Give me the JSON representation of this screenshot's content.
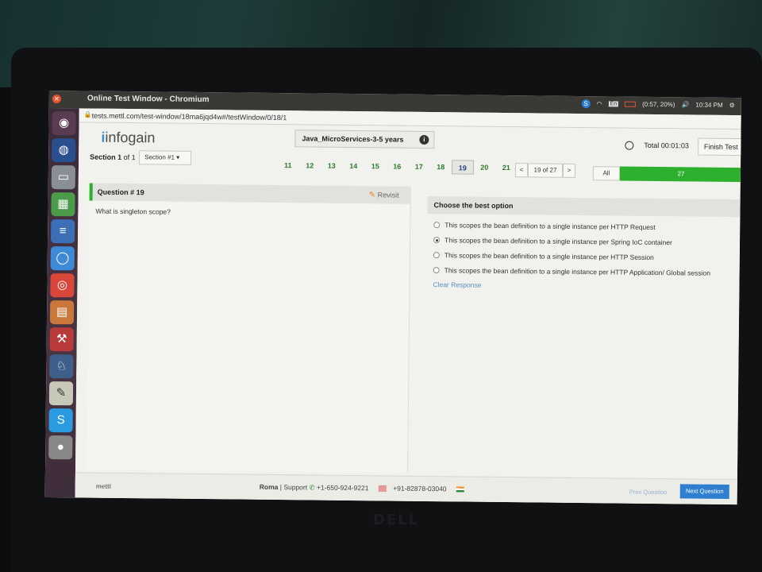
{
  "window": {
    "title": "Online Test Window - Chromium",
    "url": "tests.mettl.com/test-window/18ma6jqd4w#/testWindow/0/18/1"
  },
  "system_tray": {
    "keyboard": "En",
    "battery": "(0:57, 20%)",
    "time": "10:34 PM"
  },
  "launcher_icons": [
    "ubuntu-dash-icon",
    "network-sphere-icon",
    "files-icon",
    "spreadsheet-icon",
    "document-icon",
    "browser-icon",
    "chrome-icon",
    "presentation-icon",
    "settings-icon",
    "pgadmin-icon",
    "text-editor-icon",
    "skype-icon",
    "disk-icon"
  ],
  "header": {
    "logo": "infogain",
    "test_name": "Java_MicroServices-3-5 years",
    "total_label": "Total 00:01:03",
    "finish_label": "Finish Test"
  },
  "section": {
    "prefix": "Section",
    "number": "1",
    "of": "of 1",
    "selector": "Section #1"
  },
  "question_numbers": [
    "11",
    "12",
    "13",
    "14",
    "15",
    "16",
    "17",
    "18",
    "19",
    "20",
    "21"
  ],
  "current_question_index": 8,
  "pager": {
    "prev": "<",
    "position": "19 of 27",
    "next": ">"
  },
  "filter": {
    "all_label": "All",
    "count": "27"
  },
  "question": {
    "heading": "Question # 19",
    "revisit_label": "Revisit",
    "text": "What is singleton scope?"
  },
  "options_panel": {
    "heading": "Choose the best option",
    "options": [
      "This scopes the bean definition to a single instance per HTTP Request",
      "This scopes the bean definition to a single instance per Spring IoC container",
      "This scopes the bean definition to a single instance per HTTP Session",
      "This scopes the bean definition to a single instance per HTTP Application/ Global session"
    ],
    "selected_index": 1,
    "clear_label": "Clear Response"
  },
  "footer": {
    "brand": "mettl",
    "support_name": "Roma",
    "support_sep": "| Support",
    "phone_us": "+1-650-924-9221",
    "phone_in": "+91-82878-03040",
    "prev_label": "Prev Question",
    "next_label": "Next Question"
  },
  "device_brand": "DELL"
}
